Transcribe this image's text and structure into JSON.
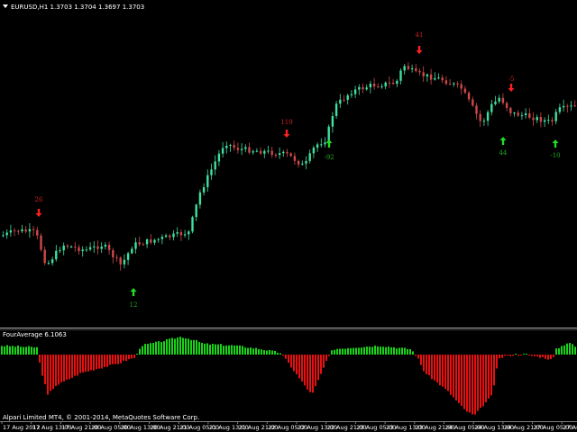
{
  "window": {
    "symbol_line": "EURUSD,H1  1.3703 1.3704 1.3697 1.3703",
    "indicator_title": "FourAverage 6.1063",
    "copyright": "Alpari Limited MT4, © 2001-2014, MetaQuotes Software Corp."
  },
  "time_axis": [
    "17 Aug 2012",
    "17 Aug 13:00",
    "17 Aug 21:00",
    "20 Aug 05:00",
    "20 Aug 13:00",
    "20 Aug 21:00",
    "21 Aug 05:00",
    "21 Aug 13:00",
    "21 Aug 21:00",
    "22 Aug 05:00",
    "22 Aug 13:00",
    "22 Aug 21:00",
    "23 Aug 05:00",
    "23 Aug 13:00",
    "23 Aug 21:00",
    "24 Aug 05:00",
    "24 Aug 13:00",
    "24 Aug 21:00",
    "27 Aug 05:00",
    "27 Aug 13:00"
  ],
  "signals": [
    {
      "type": "sell",
      "label": "26"
    },
    {
      "type": "buy",
      "label": "12"
    },
    {
      "type": "sell",
      "label": "119"
    },
    {
      "type": "buy",
      "label": "-92"
    },
    {
      "type": "sell",
      "label": "41"
    },
    {
      "type": "buy",
      "label": "44"
    },
    {
      "type": "sell",
      "label": "-5"
    },
    {
      "type": "buy",
      "label": "-10"
    }
  ],
  "colors": {
    "background": "#000000",
    "bull_candle": "#3fe0a0",
    "bear_candle": "#d04848",
    "hist_positive": "#19d419",
    "hist_negative": "#e81010",
    "buy_arrow": "#22dd22",
    "sell_arrow": "#ff2020",
    "buy_label": "#22aa22",
    "sell_label": "#d02020",
    "separator": "#b0b0b0"
  }
}
